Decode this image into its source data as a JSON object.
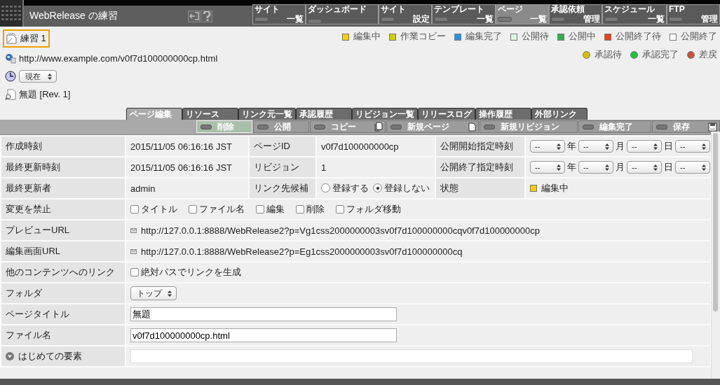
{
  "header": {
    "title": "WebRelease の練習",
    "nav": [
      {
        "top": "サイト",
        "bottom": "一覧",
        "selected": false
      },
      {
        "top": "ダッシュボード",
        "selected": false
      },
      {
        "top": "サイト",
        "bottom": "設定",
        "selected": false
      },
      {
        "top": "テンプレート",
        "bottom": "一覧",
        "selected": false
      },
      {
        "top": "ページ",
        "bottom": "一覧",
        "selected": true
      },
      {
        "top": "承認依頼",
        "bottom": "管理",
        "selected": false
      },
      {
        "top": "スケジュール",
        "bottom": "一覧",
        "selected": false
      },
      {
        "top": "FTP",
        "bottom": "管理",
        "selected": false
      }
    ]
  },
  "page": {
    "name": "練習 1",
    "url": "http://www.example.com/v0f7d100000000cp.html",
    "time_select": "現在",
    "revision": "無題 [Rev. 1]"
  },
  "legend": {
    "statuses": [
      {
        "label": "編集中",
        "color": "#f5d000"
      },
      {
        "label": "作業コピー",
        "color": "#c7d300"
      },
      {
        "label": "編集完了",
        "color": "#2196e8"
      },
      {
        "label": "公開待",
        "color": "#dff5e3"
      },
      {
        "label": "公開中",
        "color": "#2fb14a"
      },
      {
        "label": "公開終了待",
        "color": "#f04010"
      },
      {
        "label": "公開終了",
        "color": "#ffffff"
      }
    ],
    "approvals": [
      {
        "label": "承認待",
        "color": "#d4c000"
      },
      {
        "label": "承認完了",
        "color": "#1cc43a"
      },
      {
        "label": "差戻",
        "color": "#c8503f"
      }
    ]
  },
  "tabs": [
    {
      "label": "ページ編集",
      "selected": true
    },
    {
      "label": "リソース",
      "selected": false
    },
    {
      "label": "リンク元一覧",
      "selected": false
    },
    {
      "label": "承認履歴",
      "selected": false
    },
    {
      "label": "リビジョン一覧",
      "selected": false
    },
    {
      "label": "リリースログ",
      "selected": false
    },
    {
      "label": "操作履歴",
      "selected": false
    },
    {
      "label": "外部リンク",
      "selected": false
    }
  ],
  "actions": [
    {
      "label": "削除",
      "selected": true,
      "kind": "plain"
    },
    {
      "label": "公開",
      "selected": false,
      "kind": "plain"
    },
    {
      "label": "コピー",
      "selected": false,
      "kind": "copy"
    },
    {
      "label": "新規ページ",
      "selected": false,
      "kind": "new"
    },
    {
      "label": "新規リビジョン",
      "selected": false,
      "kind": "plain"
    },
    {
      "label": "編集完了",
      "selected": false,
      "kind": "plain"
    },
    {
      "label": "保存",
      "selected": false,
      "kind": "save"
    }
  ],
  "rows": [
    {
      "cells": [
        {
          "kind": "label",
          "text": "作成時刻"
        },
        {
          "kind": "text",
          "text": "2015/11/05 06:16:16 JST"
        },
        {
          "kind": "label",
          "text": "ページID"
        },
        {
          "kind": "text",
          "text": "v0f7d100000000cp"
        },
        {
          "kind": "label",
          "text": "公開開始指定時刻"
        },
        {
          "kind": "date",
          "selects": [
            "--",
            "--",
            "--",
            "--"
          ],
          "units": [
            "年",
            "月",
            "日"
          ]
        }
      ]
    },
    {
      "cells": [
        {
          "kind": "label",
          "text": "最終更新時刻"
        },
        {
          "kind": "text",
          "text": "2015/11/05 06:16:16 JST"
        },
        {
          "kind": "label",
          "text": "リビジョン"
        },
        {
          "kind": "text",
          "text": "1"
        },
        {
          "kind": "label",
          "text": "公開終了指定時刻"
        },
        {
          "kind": "date",
          "selects": [
            "--",
            "--",
            "--",
            "--"
          ],
          "units": [
            "年",
            "月",
            "日"
          ]
        }
      ]
    },
    {
      "cells": [
        {
          "kind": "label",
          "text": "最終更新者"
        },
        {
          "kind": "text",
          "text": "admin"
        },
        {
          "kind": "label",
          "text": "リンク先候補"
        },
        {
          "kind": "radios",
          "options": [
            {
              "label": "登録する",
              "selected": false
            },
            {
              "label": "登録しない",
              "selected": true
            }
          ]
        },
        {
          "kind": "label",
          "text": "状態"
        },
        {
          "kind": "status",
          "text": "編集中",
          "color": "#f5d000"
        }
      ]
    },
    {
      "cells": [
        {
          "kind": "label",
          "text": "変更を禁止"
        },
        {
          "kind": "checks",
          "options": [
            {
              "label": "タイトル",
              "checked": false
            },
            {
              "label": "ファイル名",
              "checked": false
            },
            {
              "label": "編集",
              "checked": false
            },
            {
              "label": "削除",
              "checked": false
            },
            {
              "label": "フォルダ移動",
              "checked": false
            }
          ]
        }
      ]
    },
    {
      "cells": [
        {
          "kind": "label",
          "text": "プレビューURL"
        },
        {
          "kind": "url",
          "text": "http://127.0.0.1:8888/WebRelease2?p=Vg1css2000000003sv0f7d100000000cqv0f7d100000000cp"
        }
      ]
    },
    {
      "cells": [
        {
          "kind": "label",
          "text": "編集画面URL"
        },
        {
          "kind": "url",
          "text": "http://127.0.0.1:8888/WebRelease2?p=Eg1css2000000003sv0f7d100000000cq"
        }
      ]
    },
    {
      "cells": [
        {
          "kind": "label",
          "text": "他のコンテンツへのリンク"
        },
        {
          "kind": "checks",
          "options": [
            {
              "label": "絶対パスでリンクを生成",
              "checked": false
            }
          ]
        }
      ]
    },
    {
      "cells": [
        {
          "kind": "label",
          "text": "フォルダ"
        },
        {
          "kind": "select",
          "text": "トップ"
        }
      ]
    },
    {
      "cells": [
        {
          "kind": "label",
          "text": "ページタイトル"
        },
        {
          "kind": "input",
          "value": "無題"
        }
      ]
    },
    {
      "cells": [
        {
          "kind": "label",
          "text": "ファイル名"
        },
        {
          "kind": "input",
          "value": "v0f7d100000000cp.html"
        }
      ]
    },
    {
      "cells": [
        {
          "kind": "group_label",
          "text": "はじめての要素"
        },
        {
          "kind": "wide_input"
        }
      ]
    }
  ]
}
